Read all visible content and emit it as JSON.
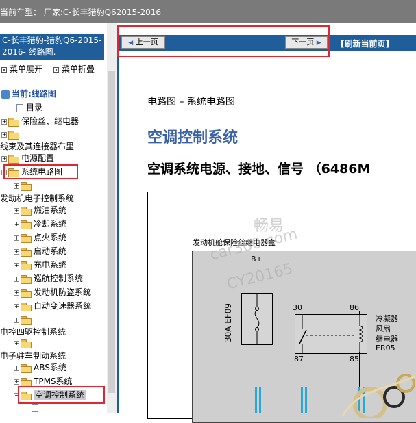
{
  "window": {
    "title": "当前车型：  厂家:C-长丰猎豹Q62015-2016"
  },
  "left_panel": {
    "header": "C-长丰猎豹-猎豹Q6-2015-2016- 线路图.",
    "menu_expand": "菜单展开",
    "menu_collapse": "菜单折叠",
    "tree": [
      {
        "label": "当前:线路图"
      },
      {
        "label": "目录"
      },
      {
        "label": "保险丝、继电器"
      },
      {
        "label": ""
      },
      {
        "label": "线束及其连接器布里"
      },
      {
        "label": "电源配置"
      },
      {
        "label": "系统电路图"
      },
      {
        "label": ""
      },
      {
        "label": "发动机电子控制系统"
      },
      {
        "label": "燃油系统"
      },
      {
        "label": "冷却系统"
      },
      {
        "label": "点火系统"
      },
      {
        "label": "启动系统"
      },
      {
        "label": "充电系统"
      },
      {
        "label": "巡航控制系统"
      },
      {
        "label": "发动机防盗系统"
      },
      {
        "label": "自动变速器系统"
      },
      {
        "label": ""
      },
      {
        "label": "电控四驱控制系统"
      },
      {
        "label": ""
      },
      {
        "label": "电子驻车制动系统"
      },
      {
        "label": "ABS系统"
      },
      {
        "label": "TPMS系统"
      },
      {
        "label": "空调控制系统"
      },
      {
        "label": ""
      }
    ]
  },
  "nav": {
    "prev": "上一页",
    "next": "下一页",
    "refresh": "[刷新当前页]"
  },
  "document": {
    "section": "电路图 – 系统电路图",
    "title": "空调控制系统",
    "subtitle": "空调系统电源、接地、信号 （6486M",
    "diagram": {
      "box_label": "发动机舱保险丝继电器盒",
      "bplus": "B+",
      "fuse": "30A EF09",
      "pin30": "30",
      "pin86": "86",
      "pin87": "87",
      "pin85": "85",
      "relay": [
        "冷凝器",
        "风扇",
        "继电器",
        "ER05"
      ]
    },
    "watermark": [
      "畅易",
      "car360.com",
      "CY20165"
    ]
  },
  "colors": {
    "nav_blue": "#1f5e9a",
    "title_blue": "#3a62a8",
    "highlight": "#e0262e",
    "wire_cyan": "#27a9d8"
  }
}
